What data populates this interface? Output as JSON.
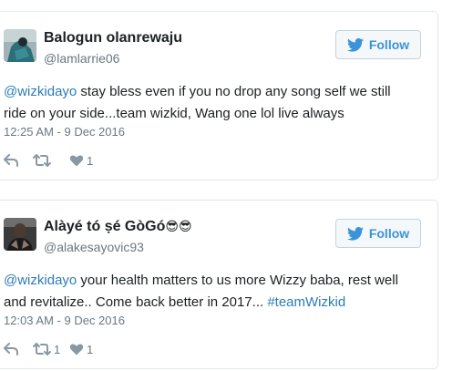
{
  "follow_label": "Follow",
  "colors": {
    "link": "#2b7bb9",
    "follow_accent": "#3b94d9",
    "meta": "#697882",
    "border": "#e1e8ed"
  },
  "tweets": [
    {
      "user_name": "Balogun olanrewaju",
      "name_emoji": "",
      "handle": "@lamlarrie06",
      "mention": "@wizkidayo",
      "text_line1": " stay bless even if you no drop any song self we still",
      "text_line2": "ride on your side...team wizkid, Wang one lol live always",
      "text_line2_tail": "",
      "hashtag": "",
      "timestamp": "12:25 AM - 9 Dec 2016",
      "retweet_count": "",
      "like_count": "1",
      "avatar_icon": "profile-photo"
    },
    {
      "user_name": "Alàyé tó ṣé GòGó",
      "name_emoji": "😎😎",
      "handle": "@alakesayovic93",
      "mention": "@wizkidayo",
      "text_line1": " your health matters to us more Wizzy baba, rest well",
      "text_line2": "and revitalize.. Come back better in 2017... ",
      "hashtag": "#teamWizkid",
      "timestamp": "12:03 AM - 9 Dec 2016",
      "retweet_count": "1",
      "like_count": "1",
      "avatar_icon": "profile-photo"
    }
  ]
}
